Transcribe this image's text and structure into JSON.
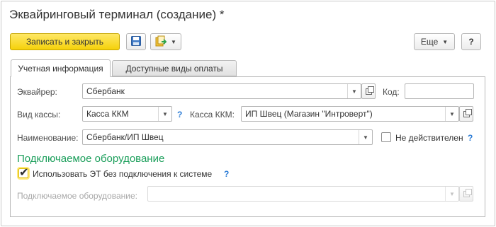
{
  "window": {
    "title": "Эквайринговый терминал (создание) *"
  },
  "toolbar": {
    "save_close_label": "Записать и закрыть",
    "save_icon": "floppy-disk-icon",
    "create_based_icon": "create-based-on-icon",
    "more_label": "Еще",
    "help_label": "?"
  },
  "tabs": [
    {
      "label": "Учетная информация",
      "active": true
    },
    {
      "label": "Доступные виды оплаты",
      "active": false
    }
  ],
  "form": {
    "acquirer": {
      "label": "Эквайрер:",
      "value": "Сбербанк"
    },
    "code": {
      "label": "Код:",
      "value": ""
    },
    "cash_type": {
      "label": "Вид кассы:",
      "value": "Касса ККМ",
      "help": "?"
    },
    "kkm": {
      "label": "Касса ККМ:",
      "value": "ИП Швец (Магазин \"Интроверт\")"
    },
    "name": {
      "label": "Наименование:",
      "value": "Сбербанк/ИП Швец"
    },
    "inactive": {
      "label": "Не действителен",
      "checked": false,
      "help": "?"
    },
    "equipment_section": "Подключаемое оборудование",
    "use_without_connection": {
      "label": "Использовать ЭТ без подключения к системе",
      "checked": true,
      "help": "?"
    },
    "equipment": {
      "label": "Подключаемое оборудование:",
      "value": ""
    }
  },
  "colors": {
    "primary_button": "#f5d10a",
    "section_title": "#1a9e5a",
    "help": "#2a7bd5"
  }
}
